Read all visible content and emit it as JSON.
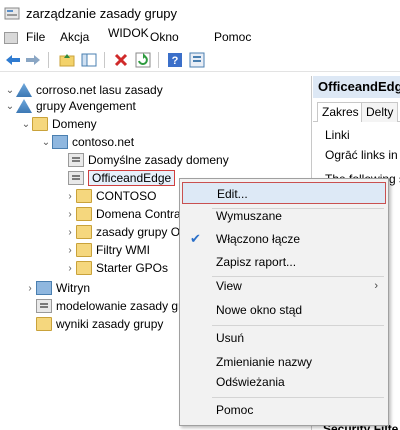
{
  "window": {
    "title": "zarządzanie zasady grupy"
  },
  "menubar": {
    "items": [
      "File",
      "Akcja",
      "WIDOK",
      "Okno",
      "Pomoc"
    ]
  },
  "toolbar": {
    "icons": [
      "back-icon",
      "forward-icon",
      "up-folder-icon",
      "show-hide-tree-icon",
      "delete-icon",
      "refresh-icon",
      "help-icon",
      "properties-icon"
    ]
  },
  "tree": {
    "root": "corroso.net lasu zasady",
    "forest": "grupy Avengement",
    "domains": "Domeny",
    "domain": "contoso.net",
    "default_policy": "Domyślne zasady domeny",
    "office_edge": "OfficeandEdge",
    "contoso": "CONTOSO",
    "domain_controllers": "Domena Contra",
    "gp_objects": "zasady grupy O",
    "wmi_filters": "Filtry WMI",
    "starter_gpos": "Starter GPOs",
    "sites": "Witryn",
    "modeling": "modelowanie zasady grupy",
    "results": "wyniki zasady grupy"
  },
  "right_pane": {
    "header": "OfficeandEdge",
    "tabs": [
      "Zakres",
      "Delty"
    ],
    "links_label": "Linki",
    "restrict_text": "Ogrāć links in t",
    "following_text": "The following si",
    "security_label": "Security Filte"
  },
  "context_menu": {
    "items": {
      "edit": "Edit...",
      "enforced": "Wymuszane",
      "link_enabled": "Włączono łącze",
      "save_report": "Zapisz raport...",
      "view": "View",
      "new_window": "Nowe okno stąd",
      "delete": "Usuń",
      "rename": "Zmienianie nazwy",
      "refresh": "Odświeżania",
      "help": "Pomoc"
    },
    "link_enabled_checked": true,
    "submenu_arrow": "›"
  },
  "colors": {
    "highlight_border": "#c95050",
    "selection_bg": "#dde9f6",
    "header_bg": "#dde8f5"
  }
}
